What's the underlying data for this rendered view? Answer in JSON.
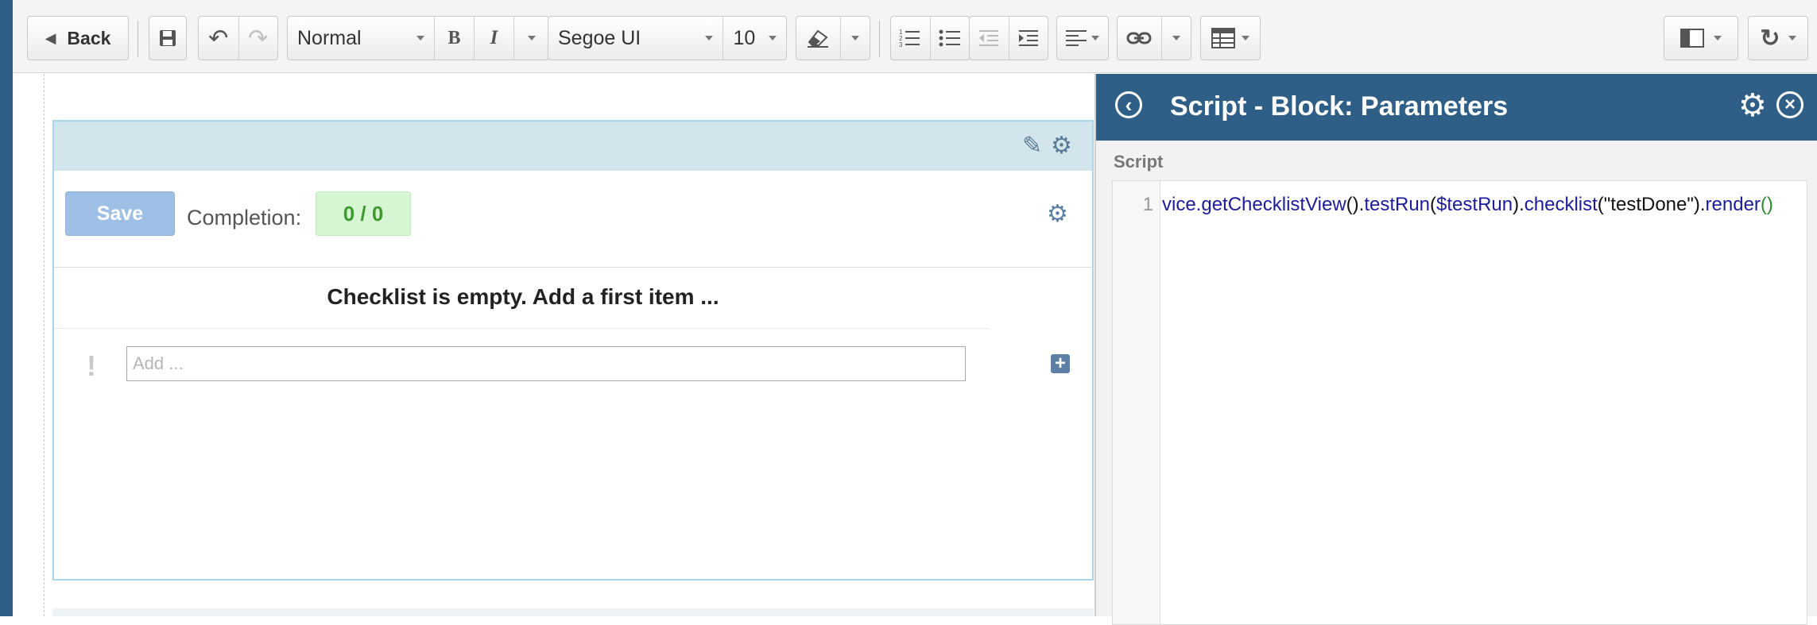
{
  "toolbar": {
    "back_label": "Back",
    "paragraph_style": "Normal",
    "font_family": "Segoe UI",
    "font_size": "10",
    "bold_label": "B",
    "italic_label": "I"
  },
  "block": {
    "save_label": "Save",
    "completion_label": "Completion:",
    "completion_value": "0 / 0",
    "empty_message": "Checklist is empty. Add a first item ...",
    "add_placeholder": "Add ...",
    "priority_mark": "!"
  },
  "panel": {
    "title": "Script - Block: Parameters",
    "section_label": "Script",
    "line_number": "1",
    "code": {
      "p1": "vice.getChecklistView",
      "p2": "().",
      "p3": "testRun",
      "p4": "(",
      "p5": "$testRun",
      "p6": ").",
      "p7": "checklist",
      "p8": "(\"testDone\").",
      "p9": "render",
      "p10": "()"
    }
  },
  "colors": {
    "header_blue": "#2f5f86",
    "save_button": "#9ec0e7",
    "completion_green": "#3c9a2f"
  }
}
